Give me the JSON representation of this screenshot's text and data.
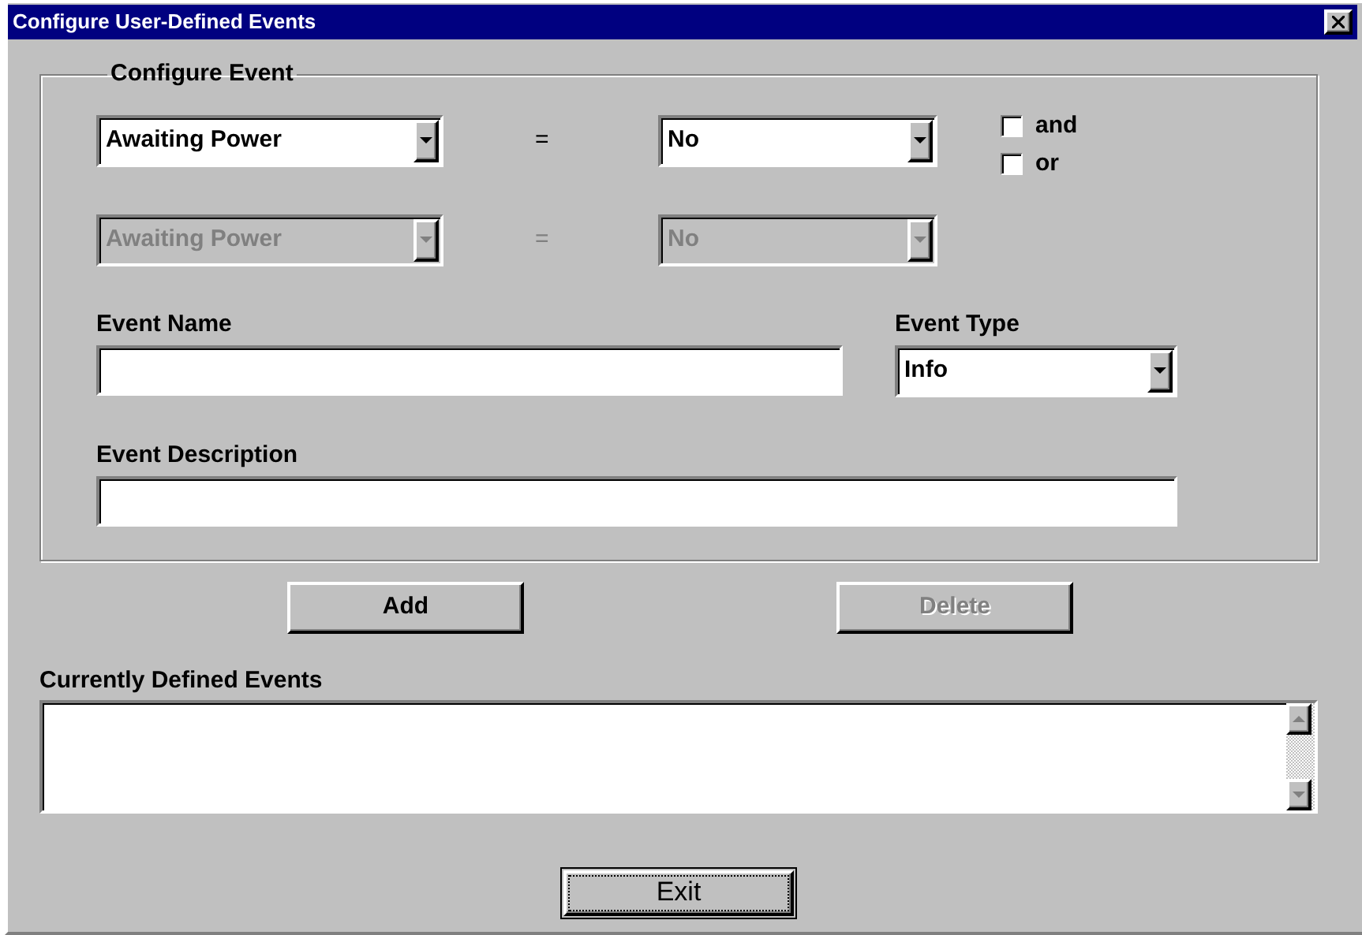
{
  "window": {
    "title": "Configure User-Defined Events"
  },
  "group": {
    "title": "Configure Event"
  },
  "conditions": [
    {
      "left": "Awaiting Power",
      "operator": "=",
      "right": "No",
      "disabled": false
    },
    {
      "left": "Awaiting Power",
      "operator": "=",
      "right": "No",
      "disabled": true
    }
  ],
  "connectors": [
    {
      "label": "and",
      "checked": false
    },
    {
      "label": "or",
      "checked": false
    }
  ],
  "event_name": {
    "label": "Event Name"
  },
  "event_type": {
    "label": "Event Type",
    "value": "Info"
  },
  "event_description": {
    "label": "Event Description"
  },
  "buttons": [
    {
      "label": "Add",
      "disabled": false
    },
    {
      "label": "Delete",
      "disabled": true
    }
  ],
  "defined_events": {
    "label": "Currently Defined Events"
  },
  "exit_button": {
    "label": "Exit",
    "focused": true
  }
}
